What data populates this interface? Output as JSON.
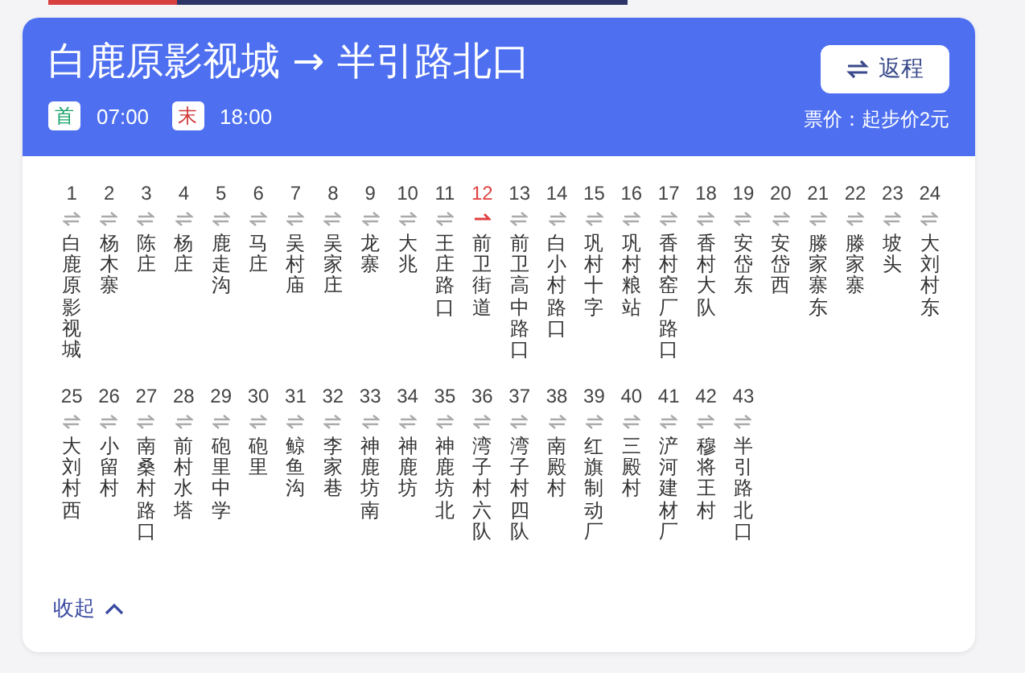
{
  "header": {
    "title": "白鹿原影视城 → 半引路北口",
    "first_bus": {
      "badge": "首",
      "time": "07:00"
    },
    "last_bus": {
      "badge": "末",
      "time": "18:00"
    },
    "return_button": "返程",
    "fare": "票价：起步价2元"
  },
  "stops": [
    {
      "number": "1",
      "name": "白鹿原影视城",
      "kind": "two_way"
    },
    {
      "number": "2",
      "name": "杨木寨",
      "kind": "two_way"
    },
    {
      "number": "3",
      "name": "陈庄",
      "kind": "two_way"
    },
    {
      "number": "4",
      "name": "杨庄",
      "kind": "two_way"
    },
    {
      "number": "5",
      "name": "鹿走沟",
      "kind": "two_way"
    },
    {
      "number": "6",
      "name": "马庄",
      "kind": "two_way"
    },
    {
      "number": "7",
      "name": "吴村庙",
      "kind": "two_way"
    },
    {
      "number": "8",
      "name": "吴家庄",
      "kind": "two_way"
    },
    {
      "number": "9",
      "name": "龙寨",
      "kind": "two_way"
    },
    {
      "number": "10",
      "name": "大兆",
      "kind": "two_way"
    },
    {
      "number": "11",
      "name": "王庄路口",
      "kind": "two_way"
    },
    {
      "number": "12",
      "name": "前卫街道",
      "kind": "one_way"
    },
    {
      "number": "13",
      "name": "前卫高中路口",
      "kind": "two_way"
    },
    {
      "number": "14",
      "name": "白小村路口",
      "kind": "two_way"
    },
    {
      "number": "15",
      "name": "巩村十字",
      "kind": "two_way"
    },
    {
      "number": "16",
      "name": "巩村粮站",
      "kind": "two_way"
    },
    {
      "number": "17",
      "name": "香村窑厂路口",
      "kind": "two_way"
    },
    {
      "number": "18",
      "name": "香村大队",
      "kind": "two_way"
    },
    {
      "number": "19",
      "name": "安岱东",
      "kind": "two_way"
    },
    {
      "number": "20",
      "name": "安岱西",
      "kind": "two_way"
    },
    {
      "number": "21",
      "name": "滕家寨东",
      "kind": "two_way"
    },
    {
      "number": "22",
      "name": "滕家寨",
      "kind": "two_way"
    },
    {
      "number": "23",
      "name": "坡头",
      "kind": "two_way"
    },
    {
      "number": "24",
      "name": "大刘村东",
      "kind": "two_way"
    },
    {
      "number": "25",
      "name": "大刘村西",
      "kind": "two_way"
    },
    {
      "number": "26",
      "name": "小留村",
      "kind": "two_way"
    },
    {
      "number": "27",
      "name": "南桑村路口",
      "kind": "two_way"
    },
    {
      "number": "28",
      "name": "前村水塔",
      "kind": "two_way"
    },
    {
      "number": "29",
      "name": "砲里中学",
      "kind": "two_way"
    },
    {
      "number": "30",
      "name": "砲里",
      "kind": "two_way"
    },
    {
      "number": "31",
      "name": "鲸鱼沟",
      "kind": "two_way"
    },
    {
      "number": "32",
      "name": "李家巷",
      "kind": "two_way"
    },
    {
      "number": "33",
      "name": "神鹿坊南",
      "kind": "two_way"
    },
    {
      "number": "34",
      "name": "神鹿坊",
      "kind": "two_way"
    },
    {
      "number": "35",
      "name": "神鹿坊北",
      "kind": "two_way"
    },
    {
      "number": "36",
      "name": "湾子村六队",
      "kind": "two_way"
    },
    {
      "number": "37",
      "name": "湾子村四队",
      "kind": "two_way"
    },
    {
      "number": "38",
      "name": "南殿村",
      "kind": "two_way"
    },
    {
      "number": "39",
      "name": "红旗制动厂",
      "kind": "two_way"
    },
    {
      "number": "40",
      "name": "三殿村",
      "kind": "two_way"
    },
    {
      "number": "41",
      "name": "浐河建材厂",
      "kind": "two_way"
    },
    {
      "number": "42",
      "name": "穆将王村",
      "kind": "two_way"
    },
    {
      "number": "43",
      "name": "半引路北口",
      "kind": "two_way"
    }
  ],
  "collapse_link": "收起"
}
